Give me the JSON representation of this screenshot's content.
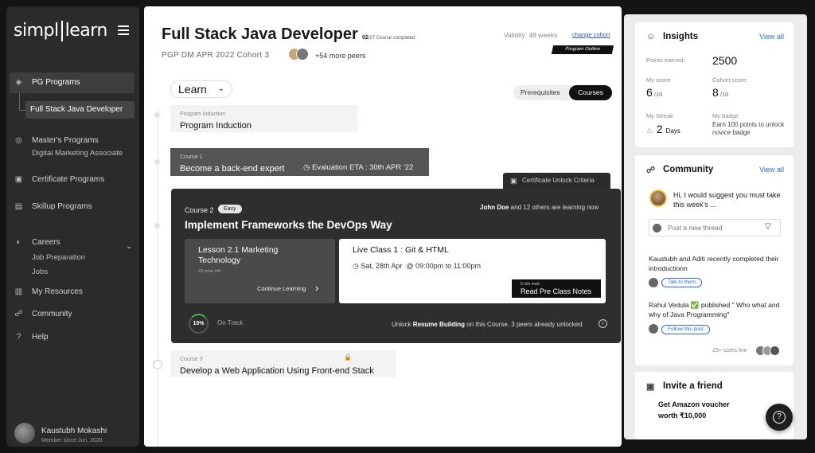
{
  "sidebar": {
    "logo": "simpl",
    "logo_rest": "learn",
    "items": [
      {
        "label": "PG Programs",
        "icon": "layers-icon"
      },
      {
        "label": "Master's Programs",
        "icon": "medal-icon"
      },
      {
        "label": "Certificate Programs",
        "icon": "certificate-icon"
      },
      {
        "label": "Skillup Programs",
        "icon": "book-icon"
      },
      {
        "label": "Careers",
        "icon": "briefcase-icon"
      },
      {
        "label": "My Resources",
        "icon": "resources-icon"
      },
      {
        "label": "Community",
        "icon": "people-icon"
      },
      {
        "label": "Help",
        "icon": "help-icon"
      }
    ],
    "pg_sub": "Full Stack Java Developer",
    "masters_sub": "Digital Marketing Associate",
    "careers_sub": [
      "Job Preparation",
      "Jobs"
    ],
    "profile": {
      "name": "Kaustubh Mokashi",
      "since": "Member since Jun, 2020"
    }
  },
  "header": {
    "title": "Full Stack Java Developer",
    "progress": "02",
    "progress_rest": "/07 Course completed",
    "cohort": "PGP DM APR 2022 Cohort 3",
    "peers": "+54 more peers",
    "validity": "Validity: 48 weeks",
    "change_cohort": "change cohort",
    "program_outline": "Program Outline"
  },
  "learn_dropdown": "Learn",
  "toggle": {
    "option1": "Prerequisites",
    "option2": "Courses"
  },
  "courses": {
    "induction": {
      "label": "Program Induction",
      "title": "Program Induction"
    },
    "c1": {
      "label": "Course 1",
      "title": "Become a back-end expert",
      "eta": "Evaluation ETA : 30th APR '22"
    },
    "cert_tab": "Certificate Unlock Criteria",
    "c2": {
      "label": "Course 2",
      "badge": "Easy",
      "title": "Implement Frameworks the DevOps Way",
      "learning_name": "John Doe",
      "learning_rest": " and 12 others are learning now",
      "lesson_title": "Lesson 2.1 Marketing Technology",
      "lesson_meta": "23 mins left",
      "continue": "Continue Learning",
      "live_title": "Live Class 1 : Git & HTML",
      "live_date": "Sat, 28th Apr",
      "live_time": "@ 09:00pm  to 11:00pm",
      "notes_small": "5 min read",
      "notes_btn": "Read Pre Class Notes",
      "progress_pct": "10%",
      "progress_value": 10,
      "status": "On Track",
      "unlock_pre": "Unlock ",
      "unlock_bold": "Resume Building",
      "unlock_post": " on this Course, 3 peers already unlocked"
    },
    "c3": {
      "label": "Course 3",
      "title": "Develop a Web Application Using Front-end Stack"
    }
  },
  "insights": {
    "title": "Insights",
    "view_all": "View all",
    "points_label": "Points earned:",
    "points": "2500",
    "my_score_label": "My score",
    "my_score": "6",
    "my_score_den": " /10",
    "cohort_score_label": "Cohort score",
    "cohort_score": "8",
    "cohort_score_den": " /10",
    "streak_label": "My Streak",
    "streak": "2",
    "streak_unit": "Days",
    "badge_label": "My badge",
    "badge_text": "Earn 100 points to unlock novice badge"
  },
  "community": {
    "title": "Community",
    "view_all": "View all",
    "message": "Hi, I would suggest you must take this week's ...",
    "thread_placeholder": "Post a new thread",
    "feed1": "Kaustubh and Aditi recently completed their introductionn",
    "feed1_pill": "Talk to them",
    "feed2": "Rahul Vedula ✅ published \" Who what and why of Java Programming\"",
    "feed2_pill": "Follow this post",
    "live_users": "23+ users live"
  },
  "invite": {
    "title": "Invite a friend",
    "text": "Get Amazon voucher worth ₹10,000"
  },
  "colors": {
    "accent": "#2a6ad8",
    "dark_card": "#2e2e2e",
    "progress_ring": "#4caf50"
  }
}
